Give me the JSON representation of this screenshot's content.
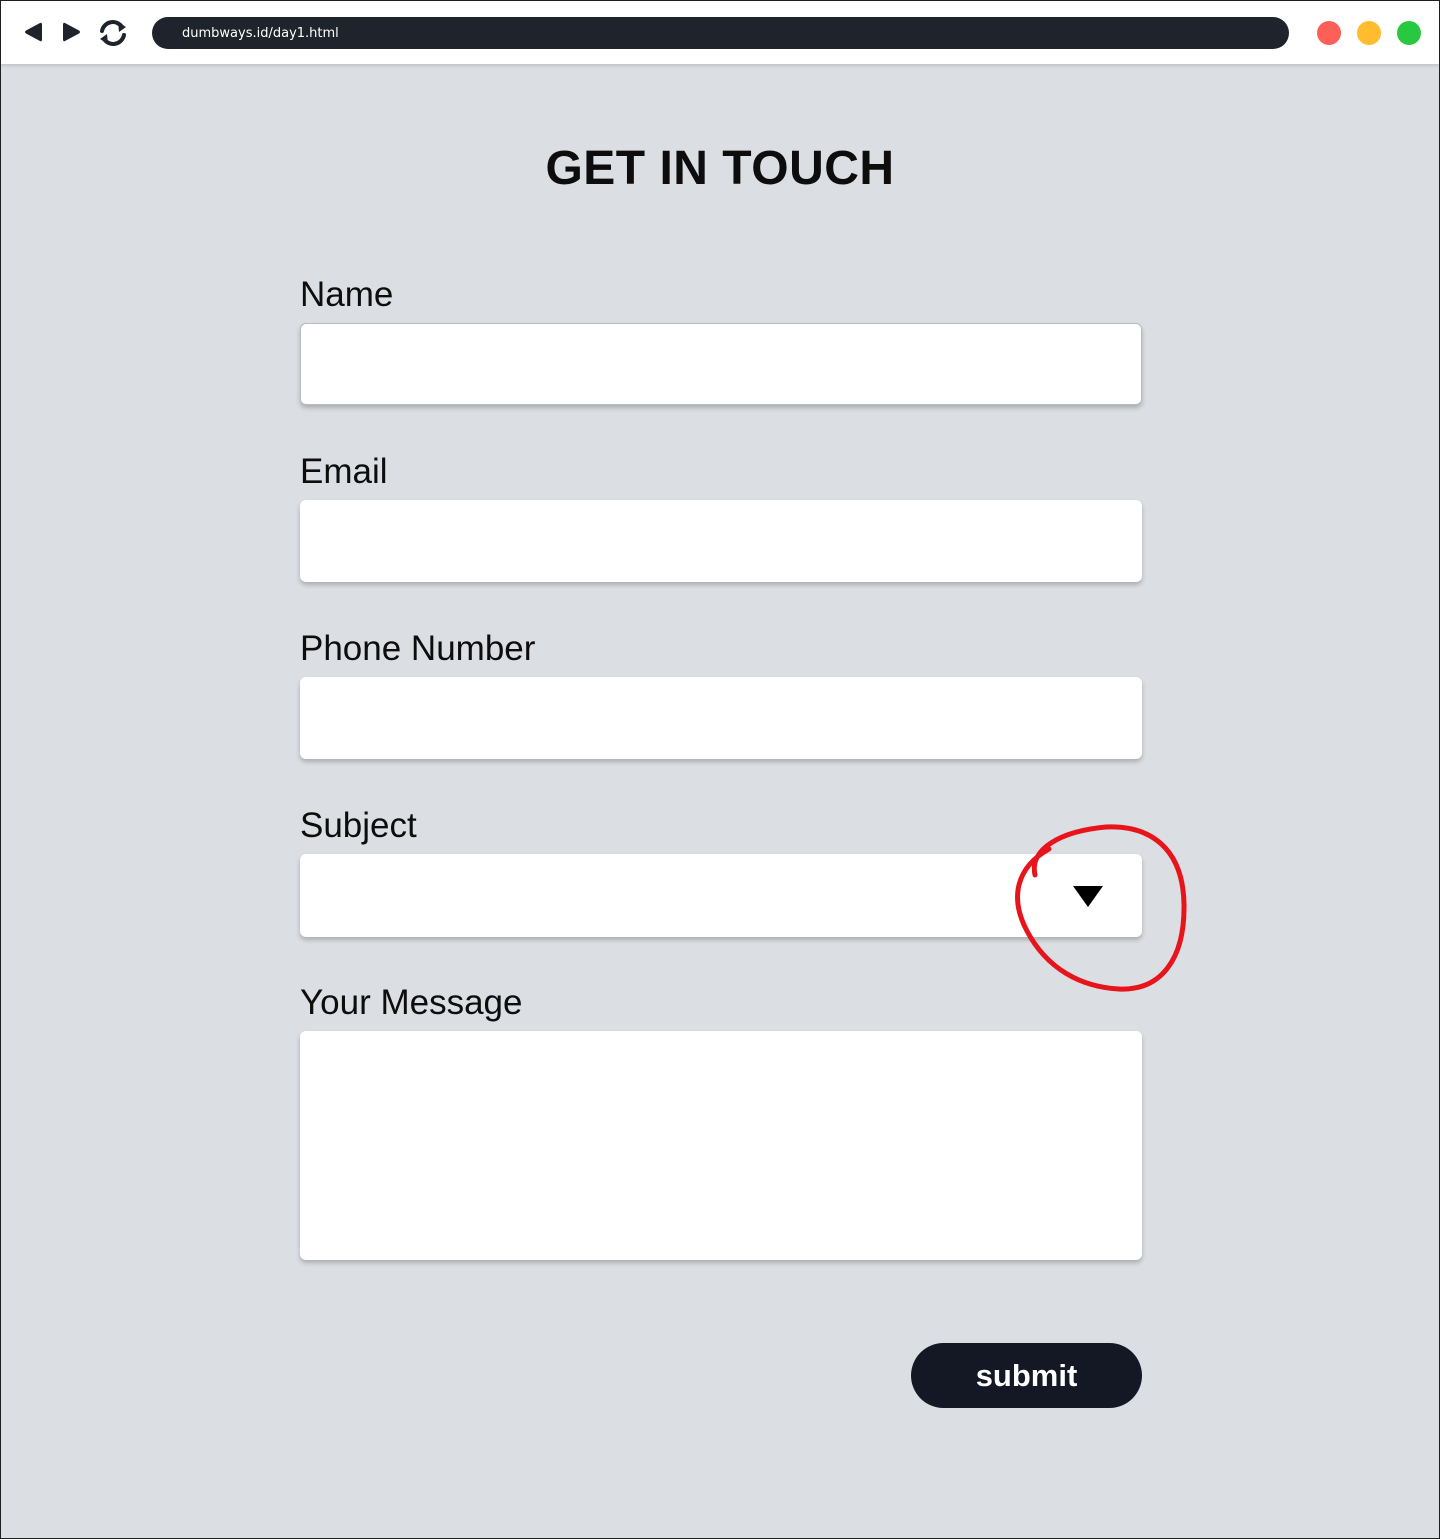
{
  "browser": {
    "url": "dumbways.id/day1.html",
    "icons": {
      "back": "back-arrow-icon",
      "forward": "forward-arrow-icon",
      "reload": "reload-icon"
    },
    "window_controls": {
      "close_color": "#fe5f57",
      "minimize_color": "#febc2e",
      "maximize_color": "#28c840"
    }
  },
  "page": {
    "title": "GET IN TOUCH",
    "background": "#dbdee3"
  },
  "form": {
    "name": {
      "label": "Name",
      "value": "",
      "placeholder": ""
    },
    "email": {
      "label": "Email",
      "value": "",
      "placeholder": ""
    },
    "phone": {
      "label": "Phone Number",
      "value": "",
      "placeholder": ""
    },
    "subject": {
      "label": "Subject",
      "selected": "",
      "icon": "triangle-down-icon"
    },
    "message": {
      "label": "Your Message",
      "value": "",
      "placeholder": ""
    },
    "submit_label": "submit"
  },
  "annotation": {
    "color": "#e8141b",
    "shape": "hand-drawn-circle"
  }
}
